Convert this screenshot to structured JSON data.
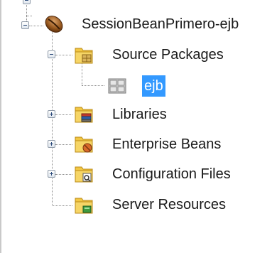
{
  "project": {
    "name": "SessionBeanPrimero-ejb",
    "nodes": [
      {
        "label": "Source Packages"
      },
      {
        "label": "ejb"
      },
      {
        "label": "Libraries"
      },
      {
        "label": "Enterprise Beans"
      },
      {
        "label": "Configuration Files"
      },
      {
        "label": "Server Resources"
      }
    ]
  },
  "colors": {
    "selection": "#3399ff",
    "folder": "#e8b52a"
  },
  "icons": {
    "project": "coffee-bean-icon",
    "source_packages": "folder-package-icon",
    "package": "package-icon",
    "libraries": "folder-library-icon",
    "enterprise_beans": "folder-bean-icon",
    "configuration_files": "folder-config-icon",
    "server_resources": "folder-server-icon"
  }
}
